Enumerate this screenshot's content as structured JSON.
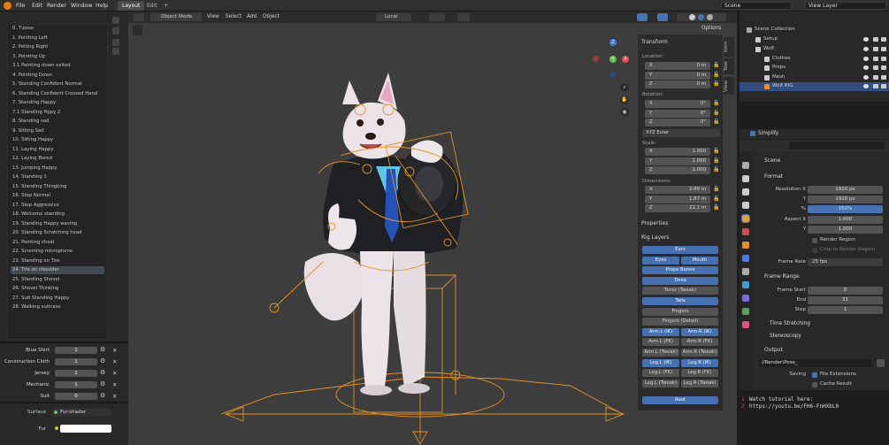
{
  "topbar": {
    "menus": [
      "File",
      "Edit",
      "Render",
      "Window",
      "Help"
    ],
    "workspaces": [
      "Layout",
      "Edit"
    ],
    "add_tab": "+",
    "scene": "Scene",
    "view_layer": "View Layer"
  },
  "viewport": {
    "mode": "Object Mode",
    "menus": [
      "View",
      "Select",
      "Add",
      "Object"
    ],
    "transform_orientation": "Local",
    "options": "Options",
    "gizmo_x": "X",
    "gizmo_y": "Y",
    "gizmo_z": "Z"
  },
  "poses": [
    "0. T-pose",
    "1. Pointing Left",
    "2. Poiting Right",
    "3. Pointing Up",
    "3.1 Pointing down exited",
    "4. Pointing Down",
    "5. Standing Confident Normal",
    "6. Standing Confident Crossed Hand",
    "7. Standing Happy",
    "7.1 Standing Hppy 2",
    "8. Standing sad",
    "9. Sitting Sad",
    "10. Sitting Happy",
    "11. Laying Happy",
    "12. Laying Bored",
    "13. Jumping Happy",
    "14. Standing 1",
    "15. Standing Thingking",
    "16. Stop Normal",
    "17. Stop Aggressive",
    "18. Welcome standing",
    "19. Standing Happy waving",
    "20. Standing Scratching head",
    "21. Pointing chest",
    "22. Screming microphone",
    "23. Standing on Tire",
    "24. Tire on shoulder",
    "25. Standing Shovel",
    "26. Shovel Thinking",
    "27. Suit Standing Happy",
    "28. Walking suitcase"
  ],
  "selected_pose_index": 26,
  "shape_keys": [
    {
      "name": "Blue Shirt",
      "value": "1"
    },
    {
      "name": "Construction Cloth",
      "value": "1"
    },
    {
      "name": "Jersey",
      "value": "1"
    },
    {
      "name": "Mechanic",
      "value": "1"
    },
    {
      "name": "Suit",
      "value": "0"
    }
  ],
  "material": {
    "surface_label": "Surface",
    "surface_value": "Fur-shader",
    "fur_label": "Fur"
  },
  "npanel": {
    "transform": "Transform",
    "location": "Location:",
    "loc": [
      {
        "k": "X",
        "v": "0 m"
      },
      {
        "k": "Y",
        "v": "0 m"
      },
      {
        "k": "Z",
        "v": "0 m"
      }
    ],
    "rotation": "Rotation:",
    "rot": [
      {
        "k": "X",
        "v": "0°"
      },
      {
        "k": "Y",
        "v": "0°"
      },
      {
        "k": "Z",
        "v": "0°"
      }
    ],
    "rot_mode": "XYZ Euler",
    "scale": "Scale:",
    "scl": [
      {
        "k": "X",
        "v": "1.000"
      },
      {
        "k": "Y",
        "v": "1.000"
      },
      {
        "k": "Z",
        "v": "1.000"
      }
    ],
    "dimensions": "Dimensions:",
    "dim": [
      {
        "k": "X",
        "v": "2.89 m"
      },
      {
        "k": "Y",
        "v": "1.87 m"
      },
      {
        "k": "Z",
        "v": "21.1 m"
      }
    ],
    "properties": "Properties",
    "rig_layers": "Rig Layers",
    "tabs": [
      "Item",
      "Tool",
      "View"
    ]
  },
  "rig_buttons": [
    {
      "label": "Ears",
      "on": true
    },
    {
      "label": "Eyes",
      "on": true
    },
    {
      "label": "Mouth",
      "on": true
    },
    {
      "label": "Props Bones",
      "on": true
    },
    {
      "label": "Torso",
      "on": true
    },
    {
      "label": "Torso (Tweak)",
      "on": false
    },
    {
      "label": "Tails",
      "on": true
    },
    {
      "label": "Fingers",
      "on": false
    },
    {
      "label": "Fingers (Detail)",
      "on": false
    },
    {
      "label": "Arm.L (IK)",
      "on": true
    },
    {
      "label": "Arm.R (IK)",
      "on": true
    },
    {
      "label": "Arm.L (FK)",
      "on": false
    },
    {
      "label": "Arm.R (FK)",
      "on": false
    },
    {
      "label": "Arm.L (Tweak)",
      "on": false
    },
    {
      "label": "Arm.R (Tweak)",
      "on": false
    },
    {
      "label": "Leg.L (IK)",
      "on": true
    },
    {
      "label": "Leg.R (IK)",
      "on": true
    },
    {
      "label": "Leg.L (FK)",
      "on": false
    },
    {
      "label": "Leg.R (FK)",
      "on": false
    },
    {
      "label": "Leg.L (Tweak)",
      "on": false
    },
    {
      "label": "Leg.R (Tweak)",
      "on": false
    },
    {
      "label": "Root",
      "on": true
    }
  ],
  "outliner": [
    {
      "name": "Scene Collection",
      "depth": 0
    },
    {
      "name": "Setup",
      "depth": 1
    },
    {
      "name": "Wolf",
      "depth": 1
    },
    {
      "name": "Clothes",
      "depth": 2
    },
    {
      "name": "Props",
      "depth": 2
    },
    {
      "name": "Mesh",
      "depth": 2
    },
    {
      "name": "Wolf RIG",
      "depth": 2
    }
  ],
  "simplify": "Simplify",
  "properties": {
    "scene": "Scene",
    "format": "Format",
    "res_x_label": "Resolution X",
    "res_x": "1920 px",
    "res_y_label": "Y",
    "res_y": "1920 px",
    "pct_label": "%",
    "pct": "150%",
    "aspect_x_label": "Aspect X",
    "aspect_x": "1.000",
    "aspect_y_label": "Y",
    "aspect_y": "1.000",
    "render_region": "Render Region",
    "crop": "Crop to Render Region",
    "frame_rate_label": "Frame Rate",
    "frame_rate": "25 fps",
    "frame_range": "Frame Range",
    "frame_start_label": "Frame Start",
    "frame_start": "0",
    "end_label": "End",
    "end": "31",
    "step_label": "Step",
    "step": "1",
    "time_stretching": "Time Stretching",
    "stereoscopy": "Stereoscopy",
    "output": "Output",
    "path": "//Render\\Pose_",
    "saving_label": "Saving",
    "file_ext": "File Extensions",
    "cache": "Cache Result"
  },
  "console": {
    "line1_no": "1",
    "line1": "Watch tutorial here:",
    "line2_no": "2",
    "line2": "https://youtu.be/FH6-FnHXbL0"
  },
  "colors": {
    "accent": "#4772b3",
    "rig_orange": "#e8911f",
    "bg": "#3d3d3d"
  }
}
